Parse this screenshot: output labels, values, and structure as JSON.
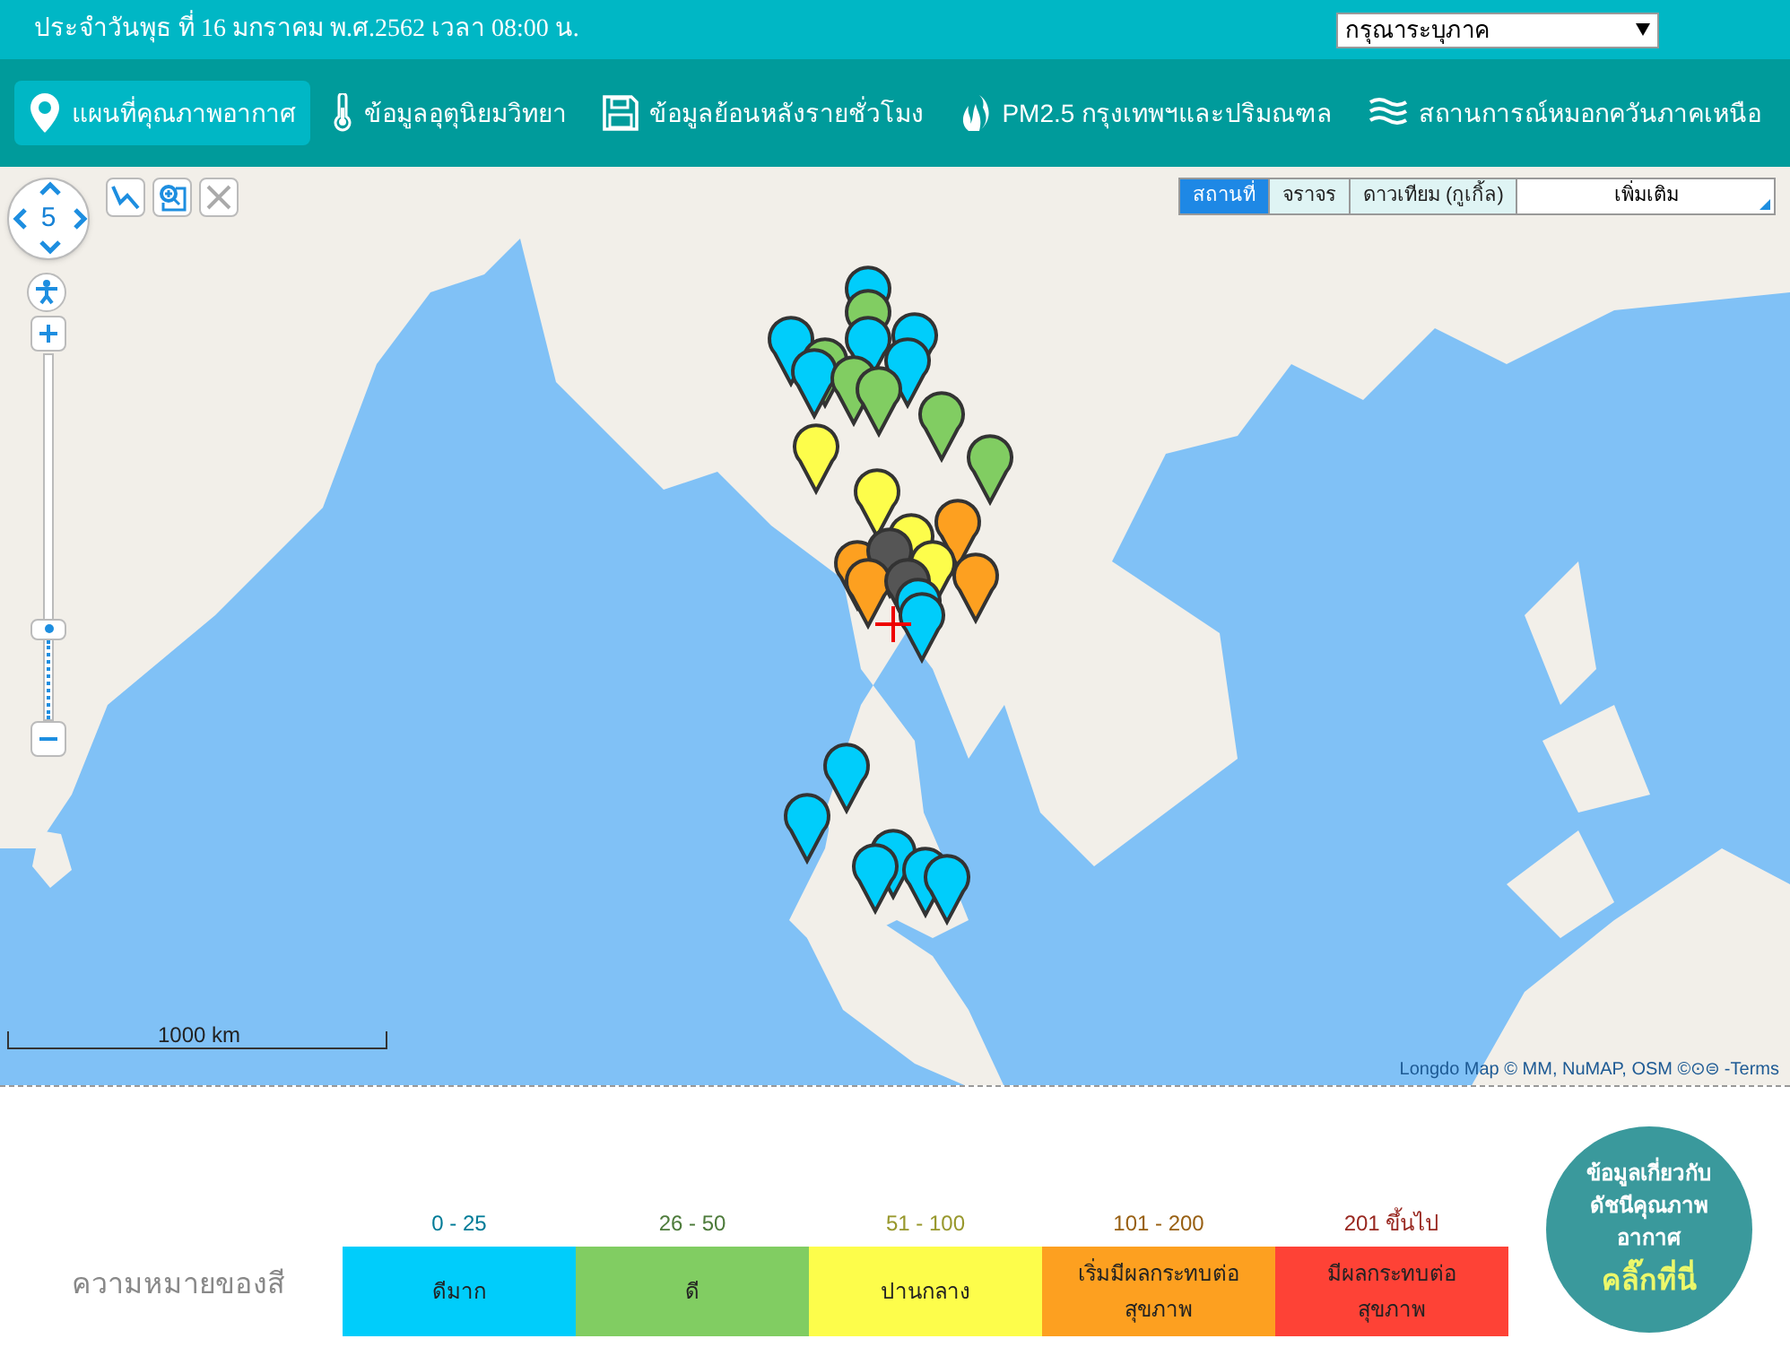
{
  "header": {
    "date_text": "ประจำวันพุธ ที่ 16 มกราคม พ.ศ.2562 เวลา 08:00 น.",
    "region_select": {
      "value": "กรุณาระบุภาค"
    }
  },
  "nav": [
    {
      "kind": "pin",
      "label": "แผนที่คุณภาพอากาศ",
      "selected": true
    },
    {
      "kind": "thermometer",
      "label": "ข้อมูลอุตุนิยมวิทยา",
      "selected": false
    },
    {
      "kind": "disk",
      "label": "ข้อมูลย้อนหลังรายชั่วโมง",
      "selected": false
    },
    {
      "kind": "flame",
      "label": "PM2.5 กรุงเทพฯและปริมณฑล",
      "selected": false
    },
    {
      "kind": "waves",
      "label": "สถานการณ์หมอกควันภาคเหนือ",
      "selected": false
    }
  ],
  "map": {
    "zoom_level": "5",
    "layer_tabs": [
      {
        "label": "สถานที่",
        "selected": true
      },
      {
        "label": "จราจร",
        "selected": false
      },
      {
        "label": "ดาวเทียม (กูเกิ้ล)",
        "selected": false
      }
    ],
    "more_select": {
      "value": "เพิ่มเติม"
    },
    "scale": "1000 km",
    "zoom_slider": {
      "level": 0.25
    },
    "attribution": {
      "text": "Longdo Map © MM, NuMAP, OSM ©⊙⊜ - ",
      "link": "Terms"
    }
  },
  "legend": {
    "title": "ความหมายของสี",
    "items": [
      {
        "range": "0 - 25",
        "label": "ดีมาก",
        "color": "#00cdfb"
      },
      {
        "range": "26 - 50",
        "label": "ดี",
        "color": "#81cd62"
      },
      {
        "range": "51 - 100",
        "label": "ปานกลาง",
        "color": "#fdfd4b"
      },
      {
        "range": "101 - 200",
        "label": "เริ่มมีผลกระทบต่อสุขภาพ",
        "color": "#fda020"
      },
      {
        "range": "201 ขึ้นไป",
        "label": "มีผลกระทบต่อสุขภาพ",
        "color": "#fe4236"
      }
    ]
  },
  "info_button": {
    "title": "ข้อมูลเกี่ยวกับดัชนีคุณภาพอากาศ",
    "link": "คลิ๊กที่นี่"
  }
}
